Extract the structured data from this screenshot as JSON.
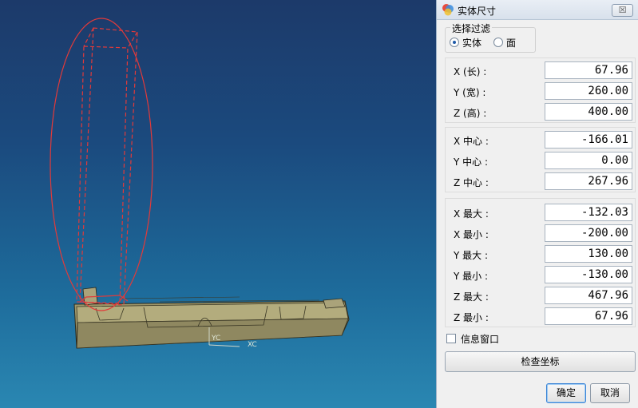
{
  "dialog": {
    "title": "实体尺寸",
    "close_symbol": "☒",
    "filter": {
      "legend": "选择过滤",
      "options": [
        {
          "label": "实体",
          "selected": true
        },
        {
          "label": "面",
          "selected": false
        }
      ]
    },
    "size_rows": [
      {
        "label": "X (长) :",
        "value": "67.96"
      },
      {
        "label": "Y (宽) :",
        "value": "260.00"
      },
      {
        "label": "Z (高) :",
        "value": "400.00"
      }
    ],
    "center_rows": [
      {
        "label": "X 中心 :",
        "value": "-166.01"
      },
      {
        "label": "Y 中心 :",
        "value": "0.00"
      },
      {
        "label": "Z 中心 :",
        "value": "267.96"
      }
    ],
    "extent_rows": [
      {
        "label": "X 最大 :",
        "value": "-132.03"
      },
      {
        "label": "X 最小 :",
        "value": "-200.00"
      },
      {
        "label": "Y 最大 :",
        "value": "130.00"
      },
      {
        "label": "Y 最小 :",
        "value": "-130.00"
      },
      {
        "label": "Z 最大 :",
        "value": "467.96"
      },
      {
        "label": "Z 最小 :",
        "value": "67.96"
      }
    ],
    "info_window": {
      "label": "信息窗口",
      "checked": false
    },
    "check_coord_label": "检查坐标",
    "ok_label": "确定",
    "cancel_label": "取消"
  },
  "viewport": {
    "axis_labels": {
      "yc": "YC",
      "xc": "XC"
    },
    "colors": {
      "model": "#a19a6b",
      "highlight": "#e23a3a",
      "background_top": "#1c3a6a",
      "background_bottom": "#2a87b2"
    }
  }
}
